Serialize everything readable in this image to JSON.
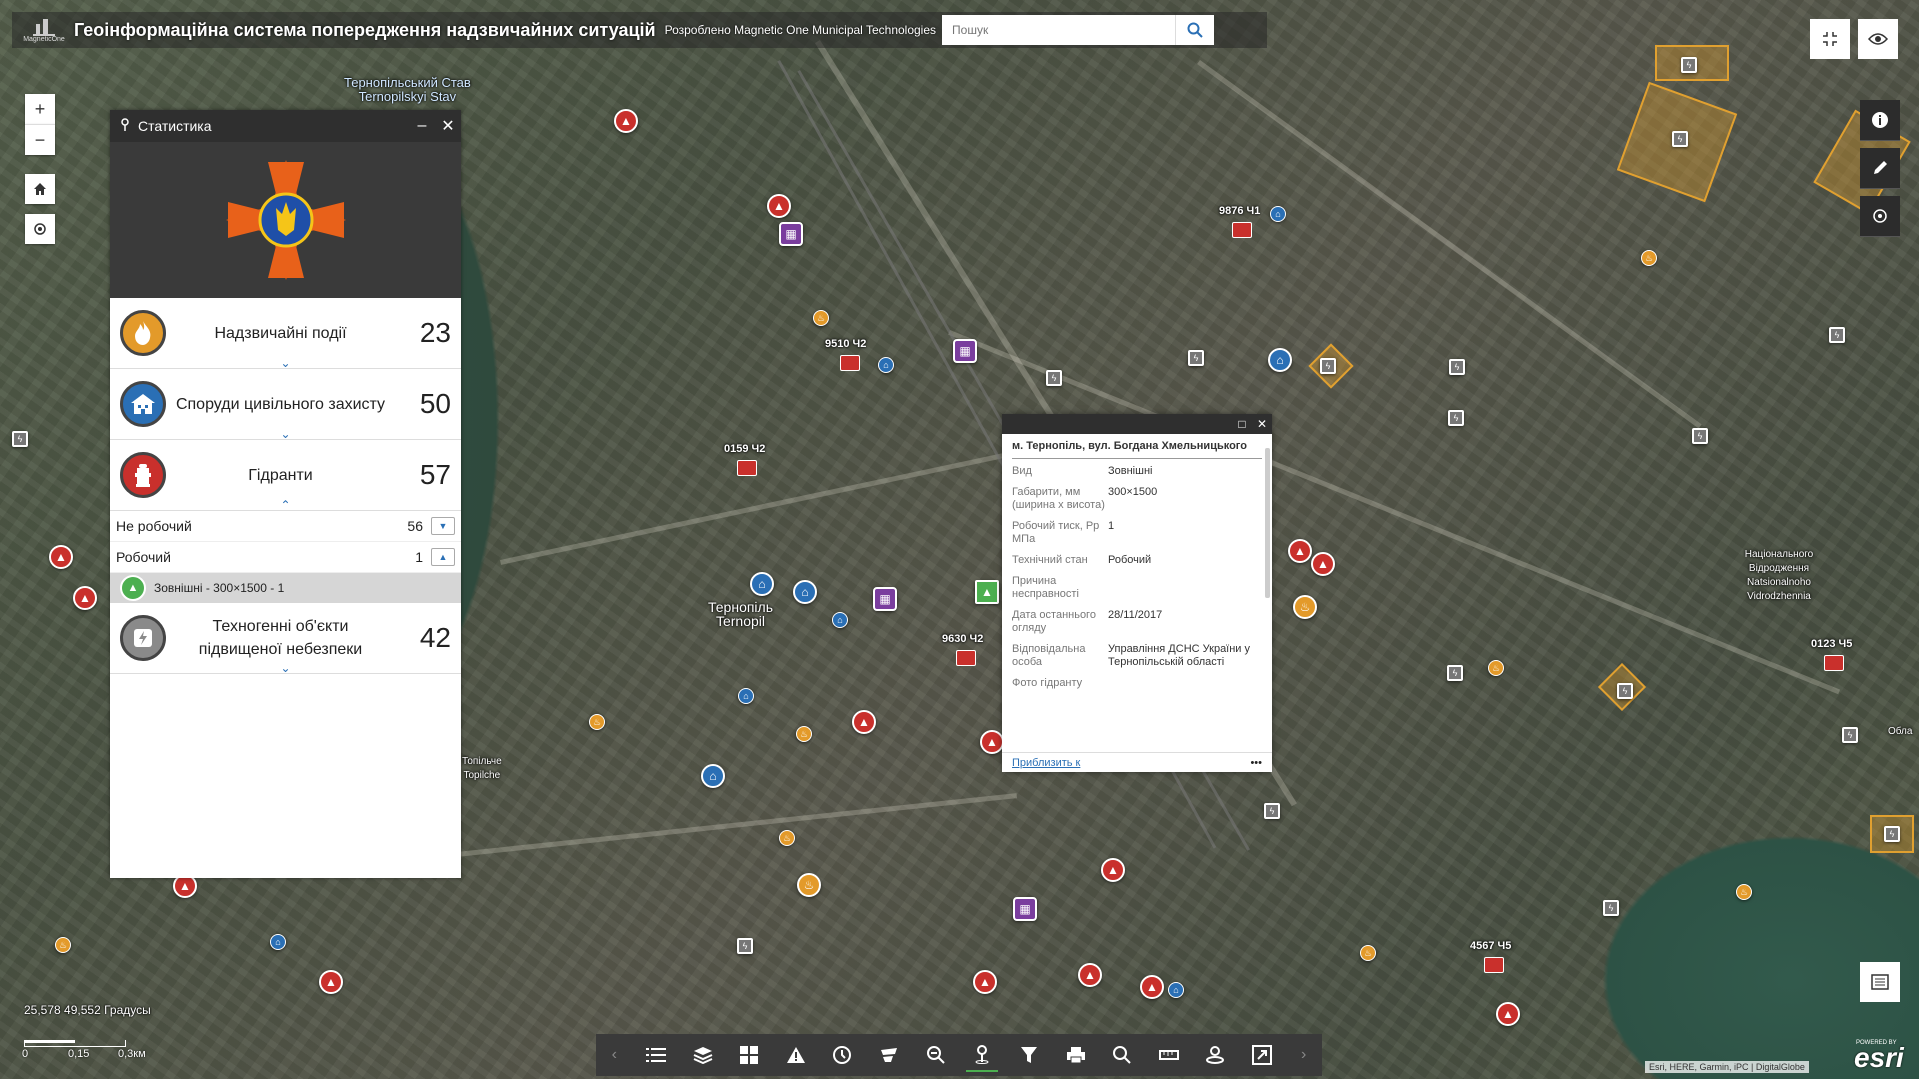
{
  "header": {
    "logo_text": "MagneticOne",
    "title": "Геоінформаційна система попередження надзвичайних ситуацій",
    "developer_credit": "Розроблено Magnetic One Municipal Technologies",
    "search_placeholder": "Пошук",
    "search_icon": "search-icon"
  },
  "map_controls": {
    "zoom_in": "+",
    "zoom_out": "−",
    "home_icon": "home-icon",
    "locate_icon": "locate-icon",
    "right_top": [
      "fullscreen-exit-icon",
      "eye-icon"
    ],
    "right_stack": [
      "info-icon",
      "edit-icon",
      "layers-toggle-icon"
    ],
    "legend_icon": "list-icon"
  },
  "place_labels": {
    "lake_ua": "Тернопільський Став",
    "lake_en": "Ternopilskyi Stav",
    "city_ua": "Тернопіль",
    "city_en": "Ternopil",
    "topilche_ua": "Топільче",
    "topilche_en": "Topilche",
    "park_ua": "Національного Відродження",
    "park_en": "Natsionalnoho Vidrodzhennia",
    "obl": "Обла"
  },
  "unit_labels": [
    "9876 Ч1",
    "9510 Ч2",
    "0159 Ч2",
    "9630 Ч2",
    "0123 Ч5",
    "4567 Ч5"
  ],
  "stats_panel": {
    "title": "Статистика",
    "minimize": "–",
    "close": "✕",
    "categories": [
      {
        "label": "Надзвичайні події",
        "count": "23",
        "color": "#e39a2a",
        "icon": "fire-icon"
      },
      {
        "label": "Споруди цивільного захисту",
        "count": "50",
        "color": "#2a6fb5",
        "icon": "shelter-icon"
      },
      {
        "label": "Гідранти",
        "count": "57",
        "color": "#c9302c",
        "icon": "hydrant-icon"
      },
      {
        "label": "Техногенні об'єкти підвищеної небезпеки",
        "count": "42",
        "color": "#8a8a8a",
        "icon": "hazard-icon"
      }
    ],
    "hydrant_states": [
      {
        "label": "Не робочий",
        "count": "56"
      },
      {
        "label": "Робочий",
        "count": "1"
      }
    ],
    "hydrant_item": "Зовнішні - 300×1500 - 1"
  },
  "popup": {
    "title": "м. Тернопіль, вул. Богдана Хмельницького",
    "maximize": "□",
    "close": "✕",
    "attributes": [
      {
        "key": "Вид",
        "value": "Зовнішні"
      },
      {
        "key": "Габарити, мм (ширина х висота)",
        "value": "300×1500"
      },
      {
        "key": "Робочий тиск, Рр МПа",
        "value": "1"
      },
      {
        "key": "Технічний стан",
        "value": "Робочий"
      },
      {
        "key": "Причина несправності",
        "value": ""
      },
      {
        "key": "Дата останнього огляду",
        "value": "28/11/2017"
      },
      {
        "key": "Відповідальна особа",
        "value": "Управління ДСНС України у Тернопільській області"
      },
      {
        "key": "Фото гідранту",
        "value": ""
      }
    ],
    "zoom_link": "Приблизить к",
    "more": "•••"
  },
  "toolbar": {
    "items": [
      "list-icon",
      "layers-icon",
      "basemap-grid-icon",
      "warning-icon",
      "history-icon",
      "bookmark-icon",
      "query-icon",
      "location-pin-icon",
      "filter-icon",
      "print-icon",
      "search-icon",
      "measure-icon",
      "directions-icon",
      "share-icon"
    ],
    "prev": "‹",
    "next": "›"
  },
  "status": {
    "coordinates": "25,578 49,552 Градусы",
    "scale_labels": [
      "0",
      "0,15",
      "0,3км"
    ],
    "attribution": "Esri, HERE, Garmin, iPC | DigitalGlobe",
    "esri_powered": "POWERED BY",
    "esri": "esri"
  },
  "colors": {
    "hydrant": "#c9302c",
    "shelter": "#2a6fb5",
    "fire": "#e39a2a",
    "tech": "#7a3d9e",
    "panel_dark": "#2f2f2f",
    "link": "#2a6fb5"
  }
}
